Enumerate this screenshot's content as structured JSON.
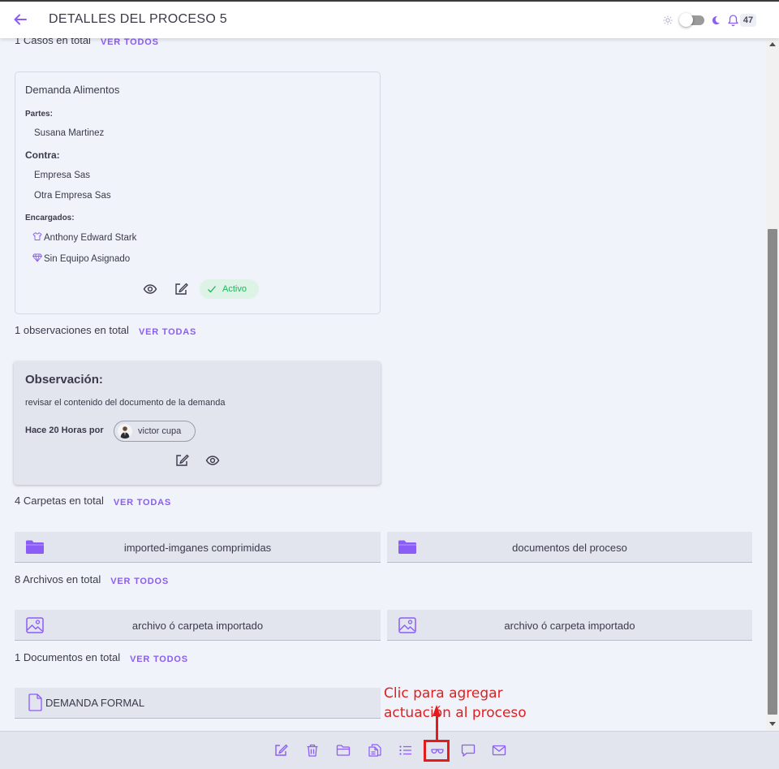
{
  "header": {
    "title": "DETALLES DEL PROCESO 5",
    "notification_count": "47",
    "accent_color": "#8b5cf6"
  },
  "cases": {
    "summary": "1 Casos en total",
    "link": "VER TODOS",
    "card": {
      "title": "Demanda Alimentos",
      "parties_label": "Partes:",
      "parties": [
        "Susana Martinez"
      ],
      "against_label": "Contra:",
      "against": [
        "Empresa Sas",
        "Otra Empresa Sas"
      ],
      "assigned_label": "Encargados:",
      "assigned": [
        "Anthony Edward Stark",
        "Sin Equipo Asignado"
      ],
      "status": "Activo",
      "status_color": "#22b35e"
    }
  },
  "observations": {
    "summary": "1 observaciones en total",
    "link": "VER TODAS",
    "card": {
      "title": "Observación:",
      "text": "revisar el contenido del documento de la demanda",
      "meta": "Hace 20 Horas por",
      "user": "victor cupa"
    }
  },
  "folders": {
    "summary": "4 Carpetas en total",
    "link": "VER TODAS",
    "items": [
      "imported-imganes comprimidas",
      "documentos del proceso"
    ]
  },
  "files": {
    "summary": "8 Archivos en total",
    "link": "VER TODOS",
    "items": [
      "archivo ó carpeta importado",
      "archivo ó carpeta importado"
    ]
  },
  "documents": {
    "summary": "1 Documentos en total",
    "link": "VER TODOS",
    "items": [
      "DEMANDA FORMAL"
    ]
  },
  "annotation": {
    "line1": "Clic para agregar",
    "line2": "actuación al proceso",
    "color": "#e51b1b"
  },
  "bottom_toolbar": {
    "icons": [
      "edit-icon",
      "trash-icon",
      "folder-icon",
      "files-icon",
      "list-icon",
      "glasses-icon",
      "comment-icon",
      "mail-icon"
    ]
  }
}
